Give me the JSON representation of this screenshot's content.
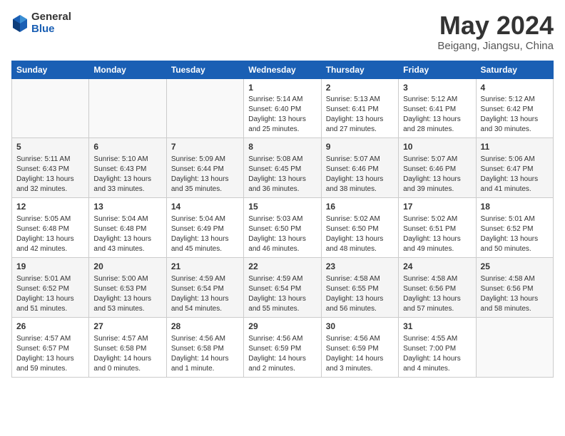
{
  "logo": {
    "general": "General",
    "blue": "Blue"
  },
  "title": {
    "month_year": "May 2024",
    "location": "Beigang, Jiangsu, China"
  },
  "headers": [
    "Sunday",
    "Monday",
    "Tuesday",
    "Wednesday",
    "Thursday",
    "Friday",
    "Saturday"
  ],
  "weeks": [
    [
      {
        "day": "",
        "info": ""
      },
      {
        "day": "",
        "info": ""
      },
      {
        "day": "",
        "info": ""
      },
      {
        "day": "1",
        "info": "Sunrise: 5:14 AM\nSunset: 6:40 PM\nDaylight: 13 hours\nand 25 minutes."
      },
      {
        "day": "2",
        "info": "Sunrise: 5:13 AM\nSunset: 6:41 PM\nDaylight: 13 hours\nand 27 minutes."
      },
      {
        "day": "3",
        "info": "Sunrise: 5:12 AM\nSunset: 6:41 PM\nDaylight: 13 hours\nand 28 minutes."
      },
      {
        "day": "4",
        "info": "Sunrise: 5:12 AM\nSunset: 6:42 PM\nDaylight: 13 hours\nand 30 minutes."
      }
    ],
    [
      {
        "day": "5",
        "info": "Sunrise: 5:11 AM\nSunset: 6:43 PM\nDaylight: 13 hours\nand 32 minutes."
      },
      {
        "day": "6",
        "info": "Sunrise: 5:10 AM\nSunset: 6:43 PM\nDaylight: 13 hours\nand 33 minutes."
      },
      {
        "day": "7",
        "info": "Sunrise: 5:09 AM\nSunset: 6:44 PM\nDaylight: 13 hours\nand 35 minutes."
      },
      {
        "day": "8",
        "info": "Sunrise: 5:08 AM\nSunset: 6:45 PM\nDaylight: 13 hours\nand 36 minutes."
      },
      {
        "day": "9",
        "info": "Sunrise: 5:07 AM\nSunset: 6:46 PM\nDaylight: 13 hours\nand 38 minutes."
      },
      {
        "day": "10",
        "info": "Sunrise: 5:07 AM\nSunset: 6:46 PM\nDaylight: 13 hours\nand 39 minutes."
      },
      {
        "day": "11",
        "info": "Sunrise: 5:06 AM\nSunset: 6:47 PM\nDaylight: 13 hours\nand 41 minutes."
      }
    ],
    [
      {
        "day": "12",
        "info": "Sunrise: 5:05 AM\nSunset: 6:48 PM\nDaylight: 13 hours\nand 42 minutes."
      },
      {
        "day": "13",
        "info": "Sunrise: 5:04 AM\nSunset: 6:48 PM\nDaylight: 13 hours\nand 43 minutes."
      },
      {
        "day": "14",
        "info": "Sunrise: 5:04 AM\nSunset: 6:49 PM\nDaylight: 13 hours\nand 45 minutes."
      },
      {
        "day": "15",
        "info": "Sunrise: 5:03 AM\nSunset: 6:50 PM\nDaylight: 13 hours\nand 46 minutes."
      },
      {
        "day": "16",
        "info": "Sunrise: 5:02 AM\nSunset: 6:50 PM\nDaylight: 13 hours\nand 48 minutes."
      },
      {
        "day": "17",
        "info": "Sunrise: 5:02 AM\nSunset: 6:51 PM\nDaylight: 13 hours\nand 49 minutes."
      },
      {
        "day": "18",
        "info": "Sunrise: 5:01 AM\nSunset: 6:52 PM\nDaylight: 13 hours\nand 50 minutes."
      }
    ],
    [
      {
        "day": "19",
        "info": "Sunrise: 5:01 AM\nSunset: 6:52 PM\nDaylight: 13 hours\nand 51 minutes."
      },
      {
        "day": "20",
        "info": "Sunrise: 5:00 AM\nSunset: 6:53 PM\nDaylight: 13 hours\nand 53 minutes."
      },
      {
        "day": "21",
        "info": "Sunrise: 4:59 AM\nSunset: 6:54 PM\nDaylight: 13 hours\nand 54 minutes."
      },
      {
        "day": "22",
        "info": "Sunrise: 4:59 AM\nSunset: 6:54 PM\nDaylight: 13 hours\nand 55 minutes."
      },
      {
        "day": "23",
        "info": "Sunrise: 4:58 AM\nSunset: 6:55 PM\nDaylight: 13 hours\nand 56 minutes."
      },
      {
        "day": "24",
        "info": "Sunrise: 4:58 AM\nSunset: 6:56 PM\nDaylight: 13 hours\nand 57 minutes."
      },
      {
        "day": "25",
        "info": "Sunrise: 4:58 AM\nSunset: 6:56 PM\nDaylight: 13 hours\nand 58 minutes."
      }
    ],
    [
      {
        "day": "26",
        "info": "Sunrise: 4:57 AM\nSunset: 6:57 PM\nDaylight: 13 hours\nand 59 minutes."
      },
      {
        "day": "27",
        "info": "Sunrise: 4:57 AM\nSunset: 6:58 PM\nDaylight: 14 hours\nand 0 minutes."
      },
      {
        "day": "28",
        "info": "Sunrise: 4:56 AM\nSunset: 6:58 PM\nDaylight: 14 hours\nand 1 minute."
      },
      {
        "day": "29",
        "info": "Sunrise: 4:56 AM\nSunset: 6:59 PM\nDaylight: 14 hours\nand 2 minutes."
      },
      {
        "day": "30",
        "info": "Sunrise: 4:56 AM\nSunset: 6:59 PM\nDaylight: 14 hours\nand 3 minutes."
      },
      {
        "day": "31",
        "info": "Sunrise: 4:55 AM\nSunset: 7:00 PM\nDaylight: 14 hours\nand 4 minutes."
      },
      {
        "day": "",
        "info": ""
      }
    ]
  ]
}
